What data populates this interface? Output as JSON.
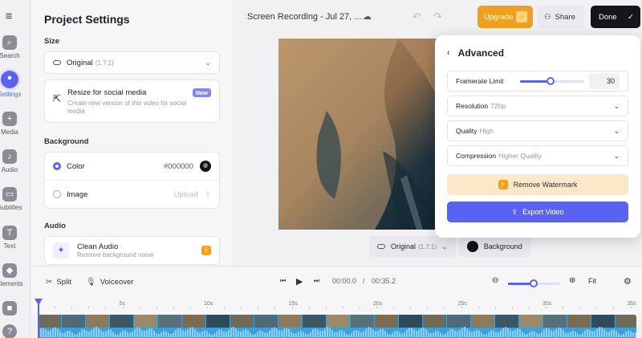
{
  "rail": {
    "menu_icon": "menu-icon",
    "items": [
      {
        "label": "Search",
        "icon": "search-icon",
        "active": false
      },
      {
        "label": "Settings",
        "icon": "settings-icon",
        "active": true
      },
      {
        "label": "Media",
        "icon": "plus-icon",
        "active": false
      },
      {
        "label": "Audio",
        "icon": "music-icon",
        "active": false
      },
      {
        "label": "Subtitles",
        "icon": "subtitles-icon",
        "active": false
      },
      {
        "label": "Text",
        "icon": "text-icon",
        "active": false
      },
      {
        "label": "Elements",
        "icon": "elements-icon",
        "active": false
      },
      {
        "label": "",
        "icon": "record-icon",
        "active": false
      },
      {
        "label": "",
        "icon": "help-icon",
        "active": false
      }
    ]
  },
  "panel": {
    "title": "Project Settings",
    "size_label": "Size",
    "size_value": "Original",
    "size_ratio": "(1.7:1)",
    "resize_title": "Resize for social media",
    "resize_sub": "Create new version of this video for social media",
    "new_badge": "New",
    "background_label": "Background",
    "color_label": "Color",
    "color_value": "#000000",
    "image_label": "Image",
    "upload_label": "Upload",
    "audio_label": "Audio",
    "clean_audio_title": "Clean Audio",
    "clean_audio_sub": "Remove background noise"
  },
  "topbar": {
    "filename": "Screen Recording - Jul 27, ...",
    "upgrade": "Upgrade",
    "share": "Share",
    "done": "Done"
  },
  "below_preview": {
    "ratio_label": "Original",
    "ratio_value": "(1.7:1)",
    "background_label": "Background"
  },
  "advanced": {
    "title": "Advanced",
    "framerate_label": "Framerate Limit",
    "framerate_value": "30",
    "framerate_slider_fraction": 0.48,
    "resolution_label": "Resolution",
    "resolution_value": "720p",
    "quality_label": "Quality",
    "quality_value": "High",
    "compression_label": "Compression",
    "compression_value": "Higher Quality",
    "remove_watermark": "Remove Watermark",
    "export_video": "Export Video"
  },
  "timeline": {
    "split": "Split",
    "voiceover": "Voiceover",
    "current_time": "00:00.0",
    "separator": "/",
    "total_time": "00:35.2",
    "fit": "Fit",
    "zoom_fraction": 0.5,
    "ruler_labels": [
      "5s",
      "10s",
      "15s",
      "20s",
      "25s",
      "30s",
      "35s"
    ]
  },
  "colors": {
    "accent": "#5a63f0",
    "upgrade": "#f0a020",
    "done_bg": "#15151a",
    "watermark_bg": "#fbe8c8",
    "track": "#3da0d8"
  }
}
